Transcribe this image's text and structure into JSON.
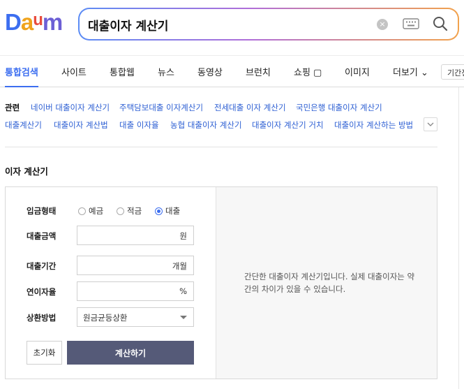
{
  "logo": {
    "text": "Daum"
  },
  "search": {
    "query": "대출이자 계산기",
    "clear_icon": "×"
  },
  "nav": {
    "tabs": [
      {
        "label": "통합검색"
      },
      {
        "label": "사이트"
      },
      {
        "label": "통합웹"
      },
      {
        "label": "뉴스"
      },
      {
        "label": "동영상"
      },
      {
        "label": "브런치"
      },
      {
        "label": "쇼핑 ▢"
      },
      {
        "label": "이미지"
      },
      {
        "label": "더보기"
      }
    ],
    "more_arrow": "⌄",
    "period_label": "기간전체"
  },
  "related": {
    "label": "관련",
    "links": [
      "네이버 대출이자 계산기",
      "주택담보대출 이자계산기",
      "전세대출 이자 계산기",
      "국민은행 대출이자 계산기",
      "대출계산기",
      "대출이자 계산법",
      "대출 이자율",
      "농협 대출이자 계산기",
      "대출이자 계산기 거치",
      "대출이자 계산하는 방법"
    ]
  },
  "calculator": {
    "title": "이자 계산기",
    "deposit_type": {
      "label": "입금형태",
      "options": [
        "예금",
        "적금",
        "대출"
      ],
      "selected": "대출"
    },
    "amount": {
      "label": "대출금액",
      "value": "",
      "unit": "원"
    },
    "period": {
      "label": "대출기간",
      "value": "",
      "unit": "개월"
    },
    "rate": {
      "label": "연이자율",
      "value": "",
      "unit": "%"
    },
    "repayment": {
      "label": "상환방법",
      "value": "원금균등상환"
    },
    "reset_label": "초기화",
    "calc_label": "계산하기",
    "description": "간단한 대출이자 계산기입니다. 실제 대출이자는 약간의 차이가 있을 수 있습니다."
  },
  "colors": {
    "accent": "#3c6ef0",
    "link": "#2d5fd3",
    "calc_button": "#555a78"
  }
}
